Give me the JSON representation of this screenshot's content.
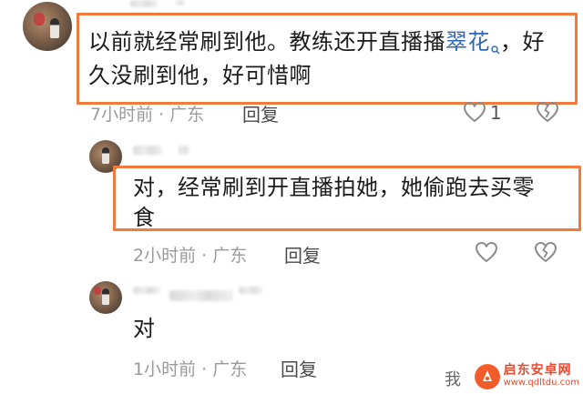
{
  "comments": [
    {
      "text_before_link": "以前就经常刷到他。教练还开直播播",
      "link_text": "翠花",
      "text_after_link": "，好久没刷到他，好可惜啊",
      "line1_before": "以前就经常刷到他。教练还开直播播",
      "line1_after": "，好",
      "line2": "久没刷到他，好可惜啊",
      "time": "7小时前 · 广东",
      "reply": "回复",
      "like_count": "1"
    },
    {
      "line1": "对，经常刷到开直播拍她，她偷跑去买零",
      "line2": "食",
      "time": "2小时前 · 广东",
      "reply": "回复"
    },
    {
      "line1": "对",
      "time": "1小时前 · 广东",
      "reply": "回复"
    }
  ],
  "icons": {
    "like": "heart-outline-icon",
    "dislike": "broken-heart-icon",
    "link_search": "search-icon"
  },
  "colors": {
    "highlight_border": "#f27a3c",
    "link": "#2f67b6",
    "meta": "#9a9a9a"
  },
  "watermark": {
    "title": "启东安卓网",
    "url": "www.qdltdu.com"
  },
  "bottom_partial_char": "我"
}
